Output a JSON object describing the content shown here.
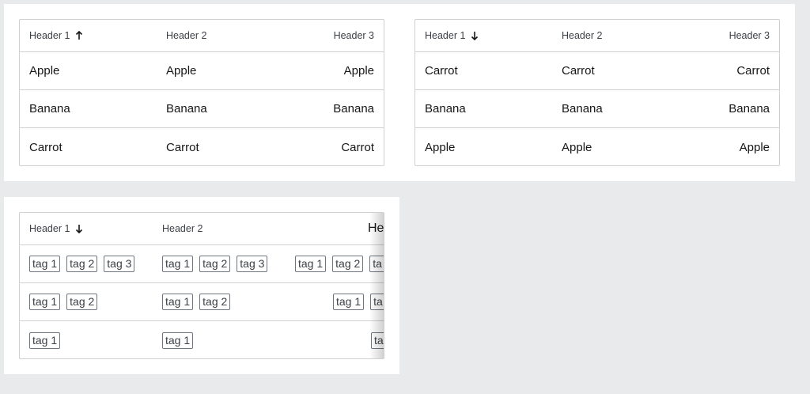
{
  "table1": {
    "headers": [
      "Header 1",
      "Header 2",
      "Header 3"
    ],
    "sort": "ascending",
    "rows": [
      [
        "Apple",
        "Apple",
        "Apple"
      ],
      [
        "Banana",
        "Banana",
        "Banana"
      ],
      [
        "Carrot",
        "Carrot",
        "Carrot"
      ]
    ]
  },
  "table2": {
    "headers": [
      "Header 1",
      "Header 2",
      "Header 3"
    ],
    "sort": "descending",
    "rows": [
      [
        "Carrot",
        "Carrot",
        "Carrot"
      ],
      [
        "Banana",
        "Banana",
        "Banana"
      ],
      [
        "Apple",
        "Apple",
        "Apple"
      ]
    ]
  },
  "table3": {
    "headers": [
      "Header 1",
      "Header 2",
      "Hea"
    ],
    "sort": "descending",
    "rows": [
      {
        "col1": [
          "tag 1",
          "tag 2",
          "tag 3"
        ],
        "col2": [
          "tag 1",
          "tag 2",
          "tag 3"
        ],
        "col3": [
          "tag 1",
          "tag 2",
          "ta"
        ]
      },
      {
        "col1": [
          "tag 1",
          "tag 2"
        ],
        "col2": [
          "tag 1",
          "tag 2"
        ],
        "col3": [
          "tag 1",
          "ta"
        ]
      },
      {
        "col1": [
          "tag 1"
        ],
        "col2": [
          "tag 1"
        ],
        "col3": [
          "ta"
        ]
      }
    ]
  },
  "icons": {
    "ascending": "arrow-up-icon",
    "descending": "arrow-down-icon"
  }
}
